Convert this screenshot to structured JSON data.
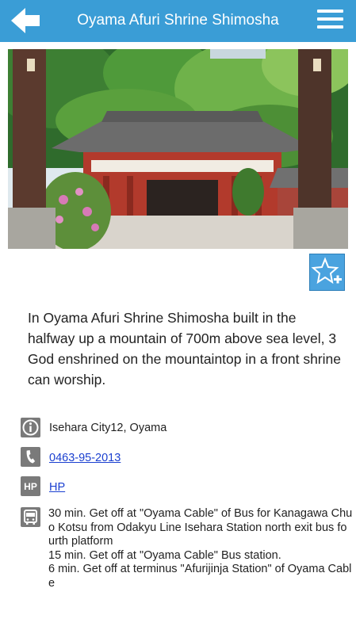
{
  "header": {
    "title": "Oyama Afuri Shrine Shimosha",
    "back_icon": "arrow-left-icon",
    "menu_icon": "hamburger-menu-icon",
    "background_color": "#3a9dd6"
  },
  "photo": {
    "subject": "shrine-photo"
  },
  "favorite_button": {
    "icon": "star-plus-icon",
    "color": "#4aa3df"
  },
  "description": "In Oyama Afuri Shrine Shimosha built in the halfway up a mountain of 700m above sea level, 3 God enshrined on the mountaintop in a front shrine can worship.",
  "info": {
    "address": {
      "icon": "info-icon",
      "text": "Isehara City12, Oyama"
    },
    "phone": {
      "icon": "phone-icon",
      "text": "0463-95-2013"
    },
    "homepage": {
      "icon_label": "HP",
      "text": "HP"
    },
    "access": {
      "icon": "bus-icon",
      "lines": [
        "30 min. Get off at \"Oyama Cable\" of Bus for Kanagawa Chuo Kotsu from Odakyu Line Isehara Station north exit bus fourth platform",
        "15 min. Get off at \"Oyama Cable\" Bus station.",
        "6 min. Get off at terminus \"Afurijinja Station\" of Oyama Cable"
      ]
    }
  }
}
